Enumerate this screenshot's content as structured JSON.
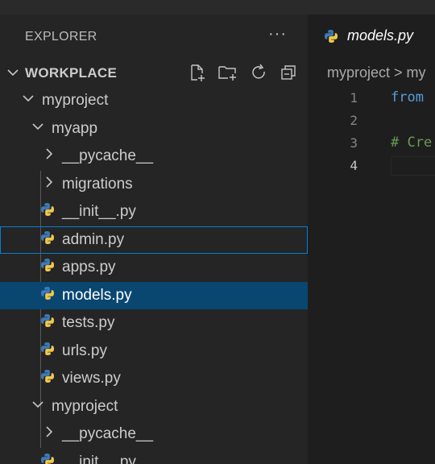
{
  "explorer": {
    "title": "EXPLORER",
    "more_label": "···",
    "workspace": "WORKPLACE"
  },
  "tree": [
    {
      "label": "myproject",
      "kind": "folder",
      "open": true
    },
    {
      "label": "myapp",
      "kind": "folder",
      "open": true
    },
    {
      "label": "__pycache__",
      "kind": "folder",
      "open": false
    },
    {
      "label": "migrations",
      "kind": "folder",
      "open": false
    },
    {
      "label": "__init__.py",
      "kind": "python"
    },
    {
      "label": "admin.py",
      "kind": "python",
      "state": "focused"
    },
    {
      "label": "apps.py",
      "kind": "python"
    },
    {
      "label": "models.py",
      "kind": "python",
      "state": "selected"
    },
    {
      "label": "tests.py",
      "kind": "python"
    },
    {
      "label": "urls.py",
      "kind": "python"
    },
    {
      "label": "views.py",
      "kind": "python"
    },
    {
      "label": "myproject",
      "kind": "folder",
      "open": true
    },
    {
      "label": "__pycache__",
      "kind": "folder",
      "open": false
    },
    {
      "label": "__init__.py",
      "kind": "python"
    }
  ],
  "editor": {
    "tab_label": "models.py",
    "breadcrumb": "myproject > my",
    "lines": [
      {
        "num": "1",
        "text": "from"
      },
      {
        "num": "2",
        "text": ""
      },
      {
        "num": "3",
        "text": "# Cre"
      },
      {
        "num": "4",
        "text": ""
      }
    ]
  },
  "colors": {
    "sidebar_bg": "#252526",
    "editor_bg": "#1e1e1e",
    "selection": "#094771",
    "focus_border": "#007fd4",
    "python_blue": "#3d7ab8",
    "python_yellow": "#f2c94c",
    "keyword": "#569cd6",
    "comment": "#6a9955"
  }
}
